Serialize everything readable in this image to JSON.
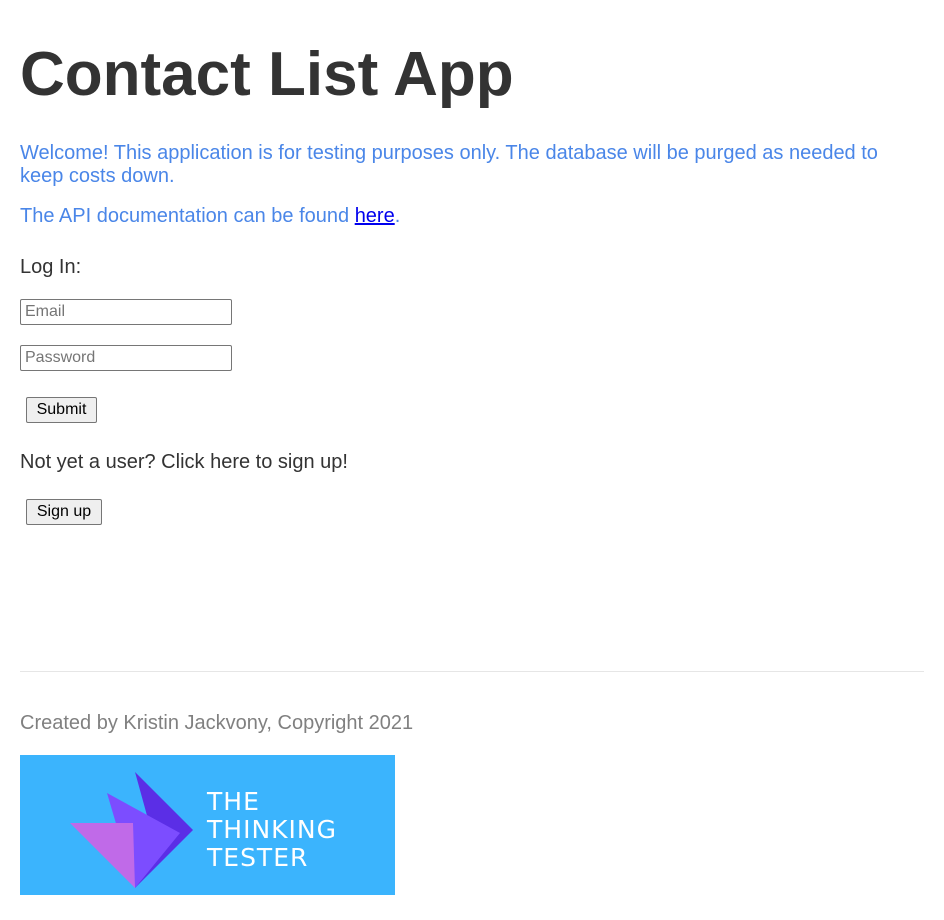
{
  "header": {
    "title": "Contact List App"
  },
  "intro": {
    "welcome": "Welcome! This application is for testing purposes only. The database will be purged as needed to keep costs down.",
    "api_prefix": "The API documentation can be found ",
    "api_link": "here",
    "api_suffix": "."
  },
  "login": {
    "label": "Log In:",
    "email_placeholder": "Email",
    "password_placeholder": "Password",
    "submit_label": "Submit"
  },
  "signup": {
    "prompt": "Not yet a user? Click here to sign up!",
    "button_label": "Sign up"
  },
  "footer": {
    "credit": "Created by Kristin Jackvony, Copyright 2021",
    "logo": {
      "lines": [
        "THE",
        "THINKING",
        "TESTER"
      ],
      "background": "#3bb4fd"
    }
  },
  "colors": {
    "accent_text": "#4a86e8",
    "link": "#0000ee",
    "heading": "#333333",
    "muted": "#808080"
  }
}
